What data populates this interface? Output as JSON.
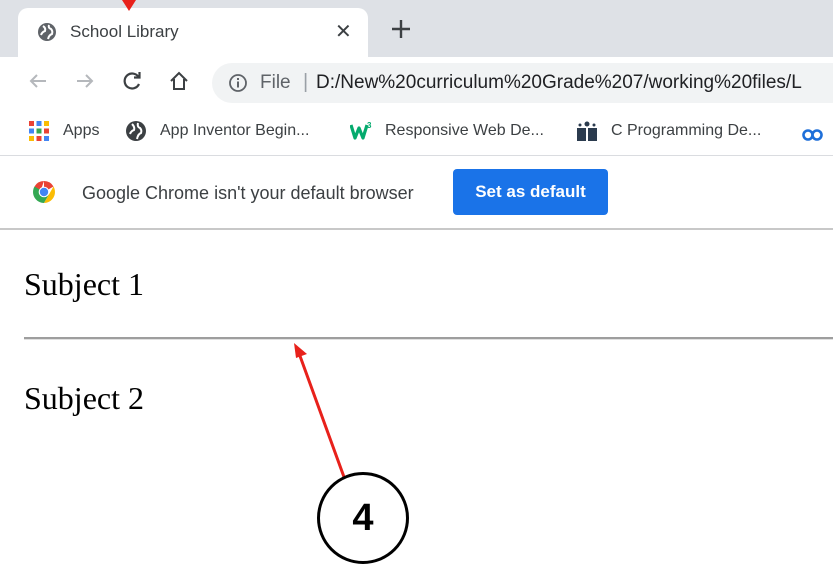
{
  "tab": {
    "title": "School Library",
    "close_glyph": "✕",
    "new_tab_glyph": "+"
  },
  "toolbar": {
    "scheme": "File",
    "separator": "|",
    "url": "D:/New%20curriculum%20Grade%207/working%20files/L"
  },
  "bookmarks": [
    {
      "label": "Apps",
      "icon": "apps-grid-icon"
    },
    {
      "label": "App Inventor Begin...",
      "icon": "globe-icon"
    },
    {
      "label": "Responsive Web De...",
      "icon": "w3schools-icon"
    },
    {
      "label": "C Programming De...",
      "icon": "book-icon"
    }
  ],
  "infobar": {
    "message": "Google Chrome isn't your default browser",
    "button_label": "Set as default"
  },
  "content": {
    "subject1": "Subject 1",
    "subject2": "Subject 2"
  },
  "annotation": {
    "number": "4",
    "color": "#e8211b"
  },
  "colors": {
    "accent": "#1a73e8",
    "tabstrip": "#dee1e6"
  }
}
